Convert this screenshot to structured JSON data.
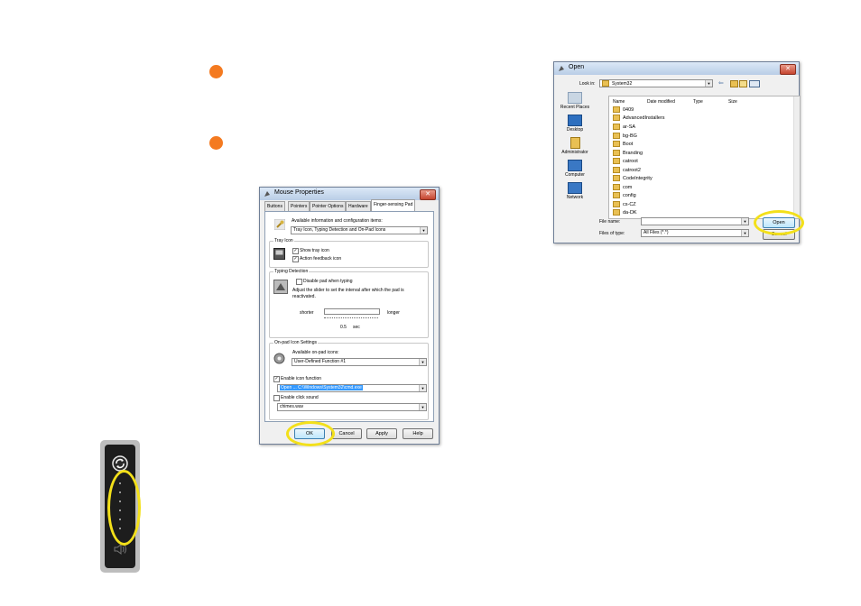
{
  "colors": {
    "bullet": "#f47a20",
    "highlight": "#f3e01a",
    "selection": "#3399ff"
  },
  "mouse_properties": {
    "title": "Mouse Properties",
    "tabs": [
      "Buttons",
      "Pointers",
      "Pointer Options",
      "Hardware",
      "Finger-sensing Pad"
    ],
    "active_tab": "Finger-sensing Pad",
    "available_info_label": "Available information and configuration items:",
    "config_select": "Tray Icon, Typing Detection and On-Pad Icons",
    "tray_icon": {
      "title": "Tray Icon",
      "show_tray_icon": {
        "label": "Show tray icon",
        "checked": true
      },
      "action_feedback_icon": {
        "label": "Action feedback icon",
        "checked": true
      }
    },
    "typing_detection": {
      "title": "Typing Detection",
      "disable_pad": {
        "label": "Disable pad when typing",
        "checked": false
      },
      "description": "Adjust the slider to set the interval after which the pad is reactivated.",
      "shorter": "shorter",
      "longer": "longer",
      "value": "0.5",
      "unit": "sec"
    },
    "onpad_icons": {
      "title": "On-pad Icon Settings",
      "available_label": "Available on-pad icons:",
      "icon_select": "User-Defined Function #1",
      "enable_icon_function": {
        "label": "Enable icon function",
        "checked": true
      },
      "function_value": "Open ... C:\\Windows\\System32\\cmd.exe",
      "enable_click_sound": {
        "label": "Enable click sound",
        "checked": false
      },
      "sound_value": "chimes.wav"
    },
    "buttons": {
      "ok": "OK",
      "cancel": "Cancel",
      "apply": "Apply",
      "help": "Help"
    }
  },
  "open_dialog": {
    "title": "Open",
    "look_in_label": "Look in:",
    "look_in_value": "System32",
    "columns": [
      "Name",
      "Date modified",
      "Type",
      "Size"
    ],
    "places": [
      "Recent Places",
      "Desktop",
      "Administrator",
      "Computer",
      "Network"
    ],
    "items": [
      "0409",
      "AdvancedInstallers",
      "ar-SA",
      "bg-BG",
      "Boot",
      "Branding",
      "catroot",
      "catroot2",
      "CodeIntegrity",
      "com",
      "config",
      "cs-CZ",
      "da-DK"
    ],
    "file_name_label": "File name:",
    "file_name_value": "",
    "files_of_type_label": "Files of type:",
    "files_of_type_value": "All Files (*.*)",
    "open_button": "Open",
    "cancel_button": "Cancel"
  }
}
